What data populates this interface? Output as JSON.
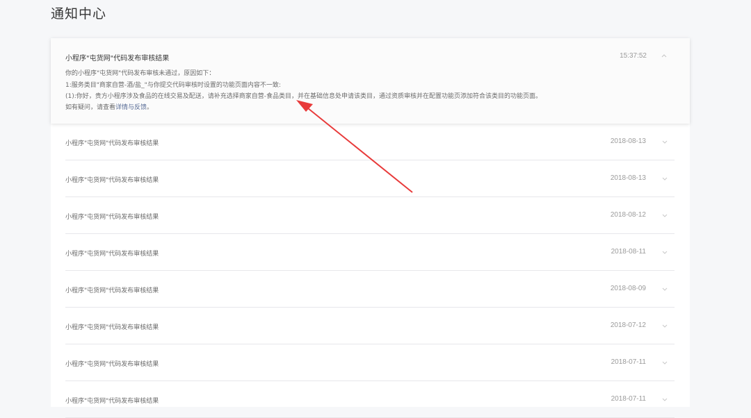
{
  "page": {
    "title": "通知中心"
  },
  "expanded_notification": {
    "title": "小程序\"屯货网\"代码发布审核结果",
    "time": "15:37:52",
    "body_line1": "你的小程序\"屯货网\"代码发布审核未通过，原因如下：",
    "body_line2": "1:服务类目\"商家自营-酒/盐_\"与你提交代码审核时设置的功能页面内容不一致:",
    "body_line3": "(1):你好，贵方小程序涉及食品的在线交易及配送，请补充选择商家自营-食品类目，并在基础信息处申请该类目，通过资质审核并在配置功能页添加符合该类目的功能页面。",
    "body_line4_prefix": "如有疑问，请查看",
    "body_line4_link": "详情与反馈",
    "body_line4_suffix": "。"
  },
  "notifications": [
    {
      "title": "小程序\"屯货网\"代码发布审核结果",
      "date": "2018-08-13"
    },
    {
      "title": "小程序\"屯货网\"代码发布审核结果",
      "date": "2018-08-13"
    },
    {
      "title": "小程序\"屯货网\"代码发布审核结果",
      "date": "2018-08-12"
    },
    {
      "title": "小程序\"屯货网\"代码发布审核结果",
      "date": "2018-08-11"
    },
    {
      "title": "小程序\"屯货网\"代码发布审核结果",
      "date": "2018-08-09"
    },
    {
      "title": "小程序\"屯货网\"代码发布审核结果",
      "date": "2018-07-12"
    },
    {
      "title": "小程序\"屯货网\"代码发布审核结果",
      "date": "2018-07-11"
    },
    {
      "title": "小程序\"屯货网\"代码发布审核结果",
      "date": "2018-07-11"
    }
  ],
  "icons": {
    "expanded_arrow": "chevron-up-icon",
    "row_arrow": "chevron-down-icon"
  },
  "colors": {
    "annotation_arrow": "#e83a3a",
    "link": "#576b95"
  }
}
